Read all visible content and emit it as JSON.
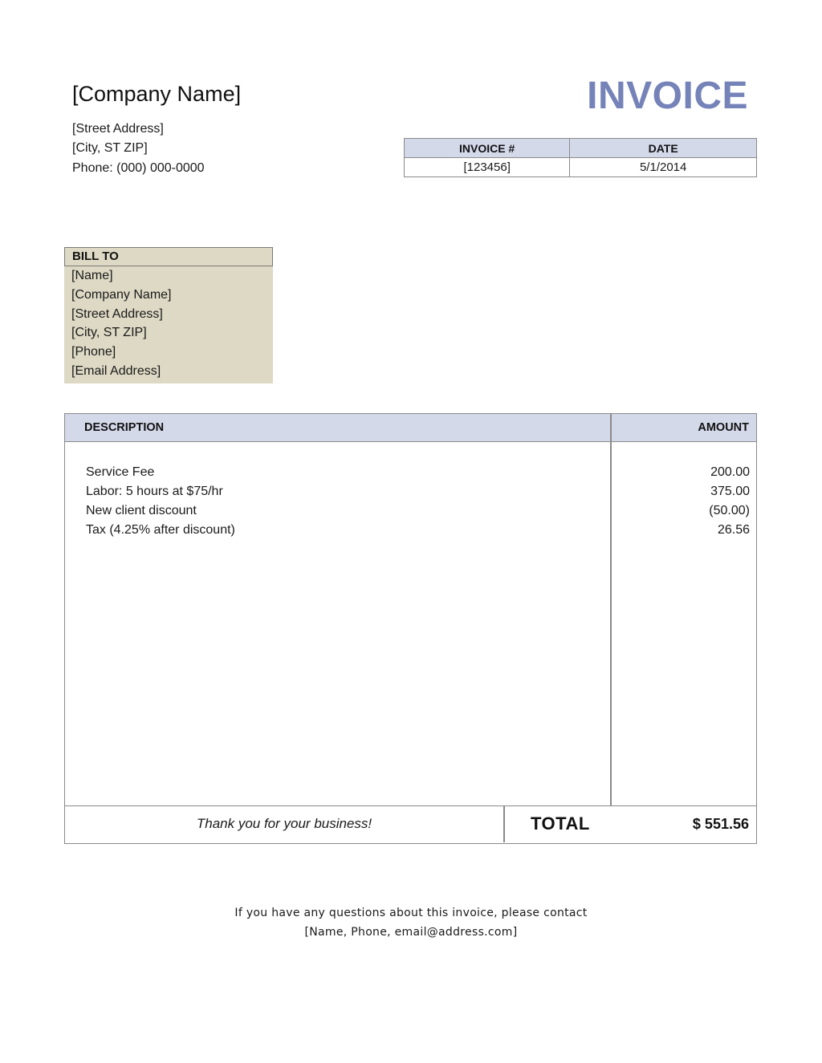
{
  "company": {
    "name": "[Company Name]",
    "street": "[Street Address]",
    "city_state_zip": "[City, ST  ZIP]",
    "phone": "Phone: (000) 000-0000"
  },
  "document_title": "INVOICE",
  "colors": {
    "title_accent": "#7583b8",
    "header_fill": "#d4d9ea",
    "billto_fill": "#ddd9c4",
    "border": "#8a8a8a"
  },
  "meta": {
    "headers": [
      "INVOICE #",
      "DATE"
    ],
    "values": [
      "[123456]",
      "5/1/2014"
    ]
  },
  "bill_to": {
    "label": "BILL TO",
    "lines": [
      "[Name]",
      "[Company Name]",
      "[Street Address]",
      "[City, ST  ZIP]",
      "[Phone]",
      "[Email Address]"
    ]
  },
  "items": {
    "headers": {
      "description": "DESCRIPTION",
      "amount": "AMOUNT"
    },
    "rows": [
      {
        "description": "Service Fee",
        "amount": "200.00"
      },
      {
        "description": "Labor: 5 hours at $75/hr",
        "amount": "375.00"
      },
      {
        "description": "New client discount",
        "amount": "(50.00)"
      },
      {
        "description": "Tax (4.25% after discount)",
        "amount": "26.56"
      }
    ],
    "thank_you": "Thank you for your business!",
    "total_label": "TOTAL",
    "total_value": "$ 551.56"
  },
  "contact": {
    "line1": "If you have any questions about this invoice, please contact",
    "line2": "[Name, Phone, email@address.com]"
  }
}
